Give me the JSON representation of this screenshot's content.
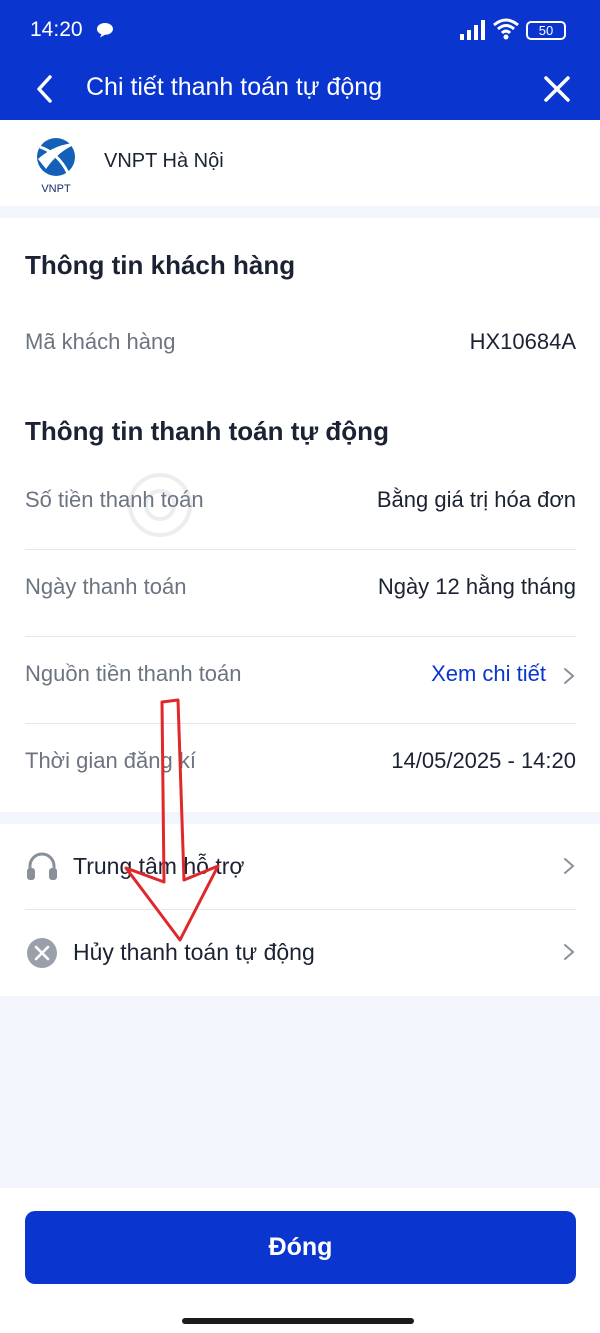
{
  "status_bar": {
    "time": "14:20",
    "battery": "50"
  },
  "app_bar": {
    "title": "Chi tiết thanh toán tự động"
  },
  "merchant": {
    "name": "VNPT Hà Nội",
    "logo_text": "VNPT"
  },
  "customer_section": {
    "title": "Thông tin khách hàng",
    "customer_code_label": "Mã khách hàng",
    "customer_code_value": "HX10684A"
  },
  "autopay_section": {
    "title": "Thông tin thanh toán tự động",
    "rows": [
      {
        "label": "Số tiền thanh toán",
        "value": "Bằng giá trị hóa đơn"
      },
      {
        "label": "Ngày thanh toán",
        "value": "Ngày 12 hằng tháng"
      },
      {
        "label": "Nguồn tiền thanh toán",
        "value": "Xem chi tiết"
      },
      {
        "label": "Thời gian đăng kí",
        "value": "14/05/2025 - 14:20"
      }
    ]
  },
  "actions": [
    {
      "label": "Trung tâm hỗ trợ",
      "icon": "headset-icon"
    },
    {
      "label": "Hủy thanh toán tự động",
      "icon": "cancel-circle-icon"
    }
  ],
  "close_button_label": "Đóng",
  "colors": {
    "primary": "#0a35cf",
    "annotation_arrow": "#e0282a"
  }
}
